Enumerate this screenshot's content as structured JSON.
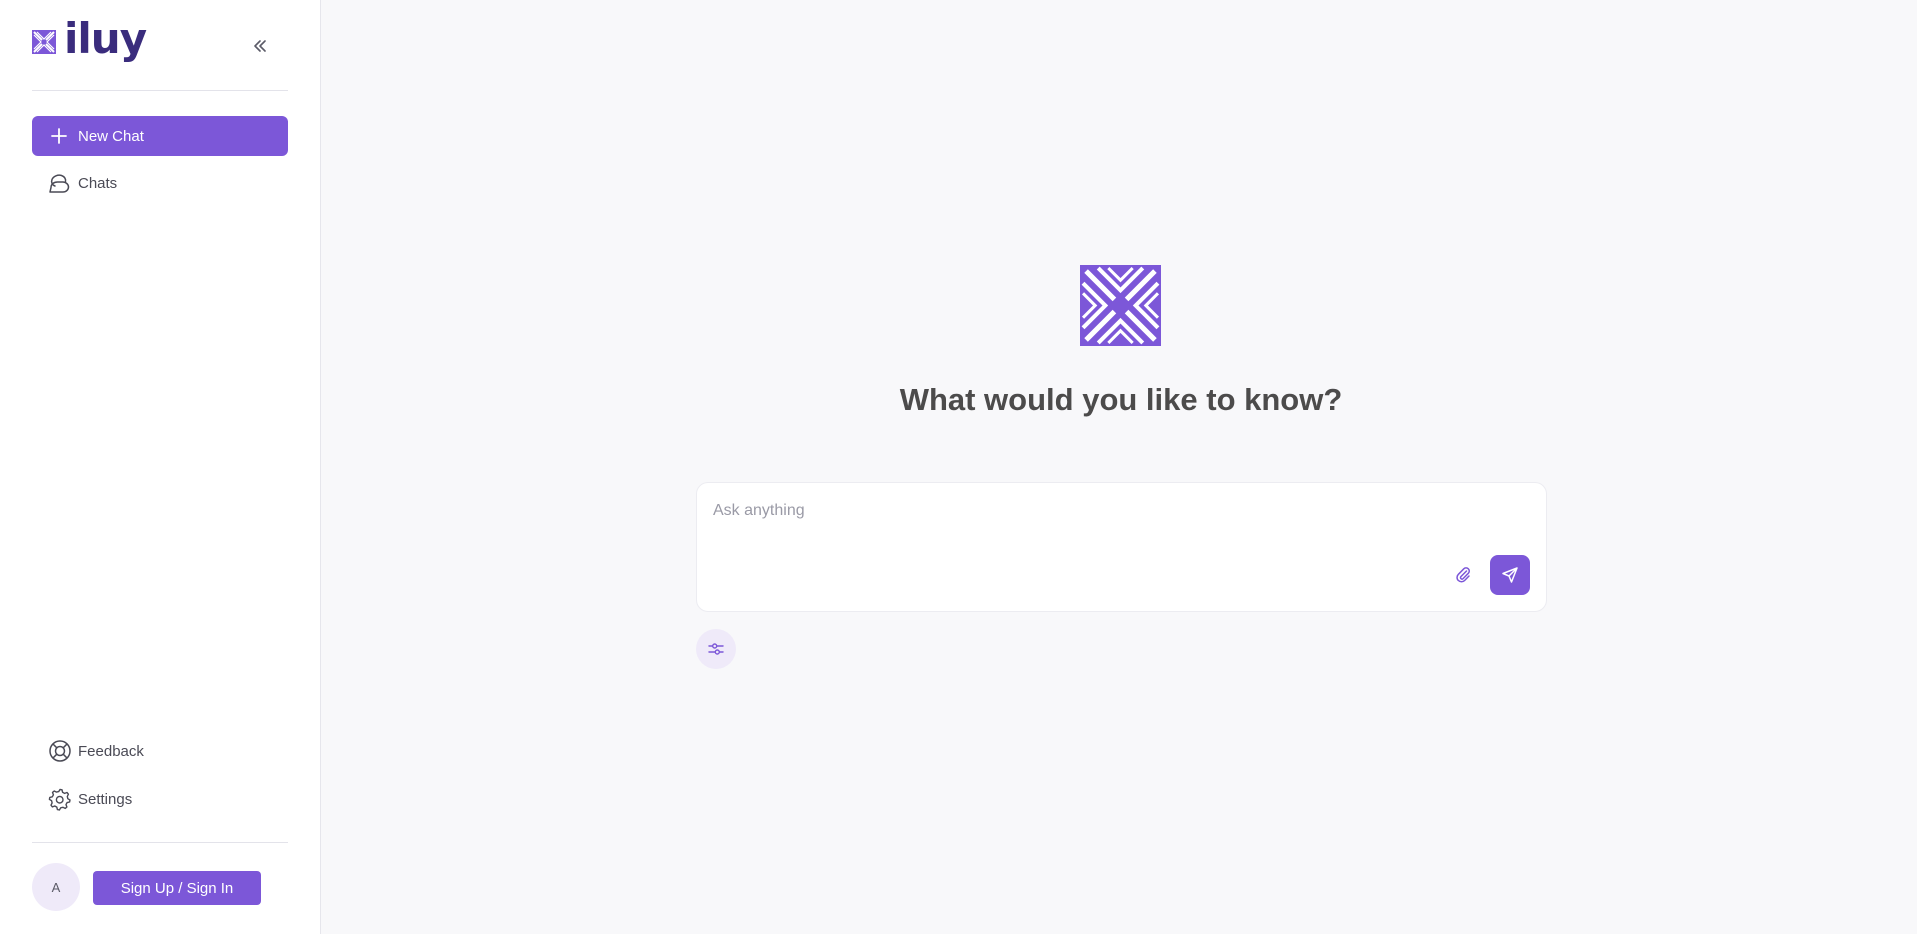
{
  "brand": {
    "name": "iluy",
    "logo_icon": "brand-logo-icon",
    "accent": "#7c57d8",
    "dark": "#3a2c7d"
  },
  "sidebar": {
    "collapse_icon": "double-chevron-left-icon",
    "new_chat_label": "New Chat",
    "chats_label": "Chats",
    "feedback_label": "Feedback",
    "settings_label": "Settings",
    "avatar_initial": "A",
    "signin_label": "Sign Up / Sign In"
  },
  "main": {
    "headline": "What would you like to know?",
    "input_placeholder": "Ask anything",
    "input_value": "",
    "attach_icon": "paperclip-icon",
    "send_icon": "send-icon",
    "options_icon": "sliders-icon"
  }
}
